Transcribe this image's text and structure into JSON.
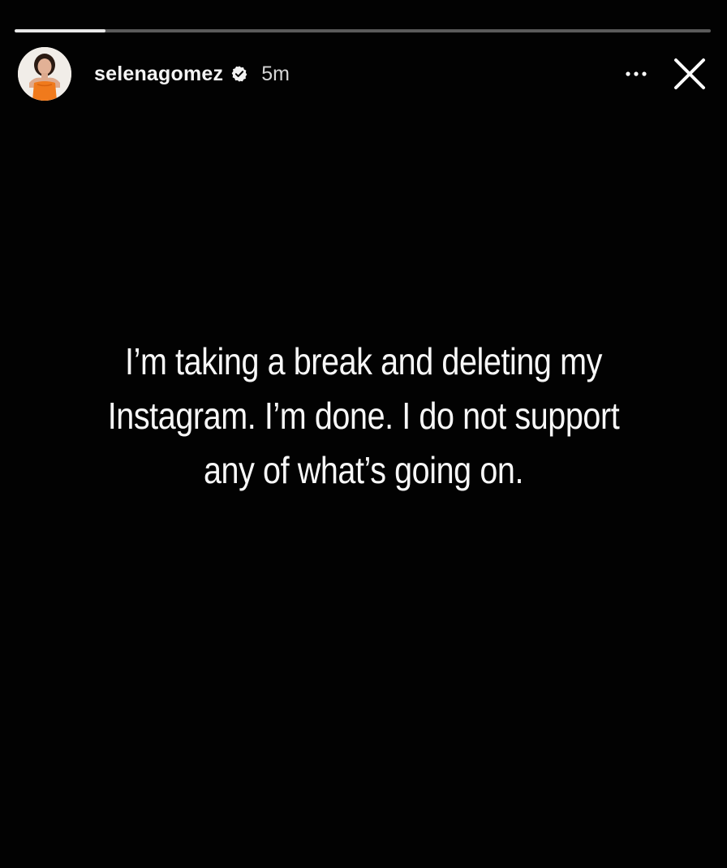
{
  "story": {
    "progress_fraction": 0.13,
    "progress_color": "#e8e8e8",
    "track_color": "#5a5a5a",
    "background": "#020202"
  },
  "header": {
    "username": "selenagomez",
    "timestamp": "5m",
    "verified_icon": "verified-badge-icon",
    "more_icon": "more-options-icon",
    "close_icon": "close-icon"
  },
  "content": {
    "lines": [
      "I’m taking a break and deleting my",
      "Instagram. I’m done. I do not support",
      "any of what’s going on."
    ]
  }
}
